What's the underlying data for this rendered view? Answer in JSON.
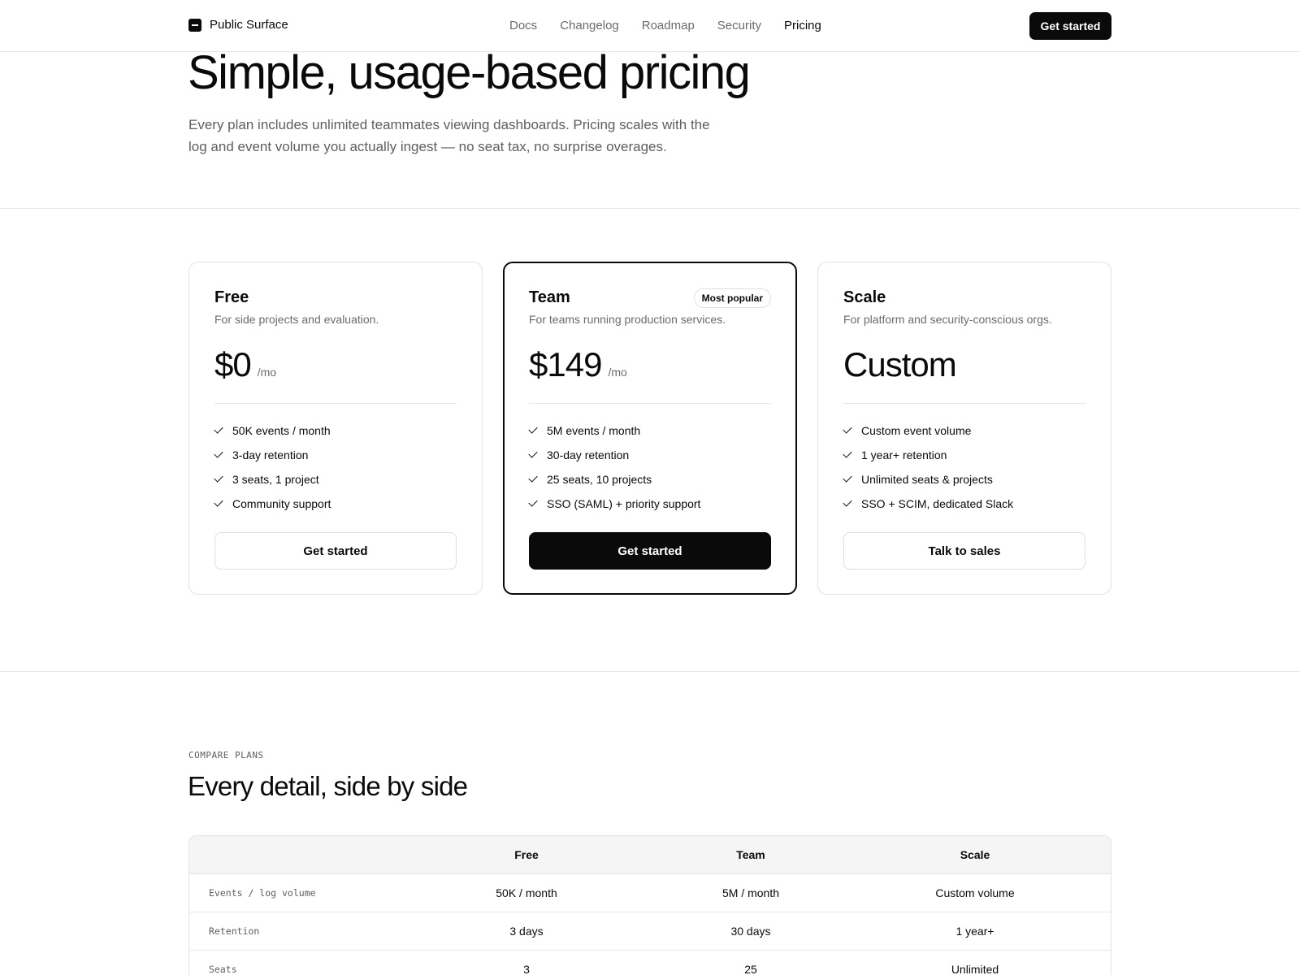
{
  "nav": {
    "brand": "Public Surface",
    "links": [
      "Docs",
      "Changelog",
      "Roadmap",
      "Security",
      "Pricing"
    ],
    "active": "Pricing",
    "cta": "Get started"
  },
  "hero": {
    "title": "Simple, usage-based pricing",
    "subtitle": "Every plan includes unlimited teammates viewing dashboards. Pricing scales with the log and event volume you actually ingest — no seat tax, no surprise overages."
  },
  "plans": [
    {
      "name": "Free",
      "description": "For side projects and evaluation.",
      "price": "$0",
      "period": "/mo",
      "features": [
        "50K events / month",
        "3-day retention",
        "3 seats, 1 project",
        "Community support"
      ],
      "cta": "Get started"
    },
    {
      "name": "Team",
      "badge": "Most popular",
      "description": "For teams running production services.",
      "price": "$149",
      "period": "/mo",
      "features": [
        "5M events / month",
        "30-day retention",
        "25 seats, 10 projects",
        "SSO (SAML) + priority support"
      ],
      "cta": "Get started"
    },
    {
      "name": "Scale",
      "description": "For platform and security-conscious orgs.",
      "price": "Custom",
      "features": [
        "Custom event volume",
        "1 year+ retention",
        "Unlimited seats & projects",
        "SSO + SCIM, dedicated Slack"
      ],
      "cta": "Talk to sales"
    }
  ],
  "compare": {
    "eyebrow": "COMPARE PLANS",
    "title": "Every detail, side by side",
    "columns": [
      "",
      "Free",
      "Team",
      "Scale"
    ],
    "rows": [
      [
        "Events / log volume",
        "50K / month",
        "5M / month",
        "Custom volume"
      ],
      [
        "Retention",
        "3 days",
        "30 days",
        "1 year+"
      ],
      [
        "Seats",
        "3",
        "25",
        "Unlimited"
      ]
    ]
  }
}
